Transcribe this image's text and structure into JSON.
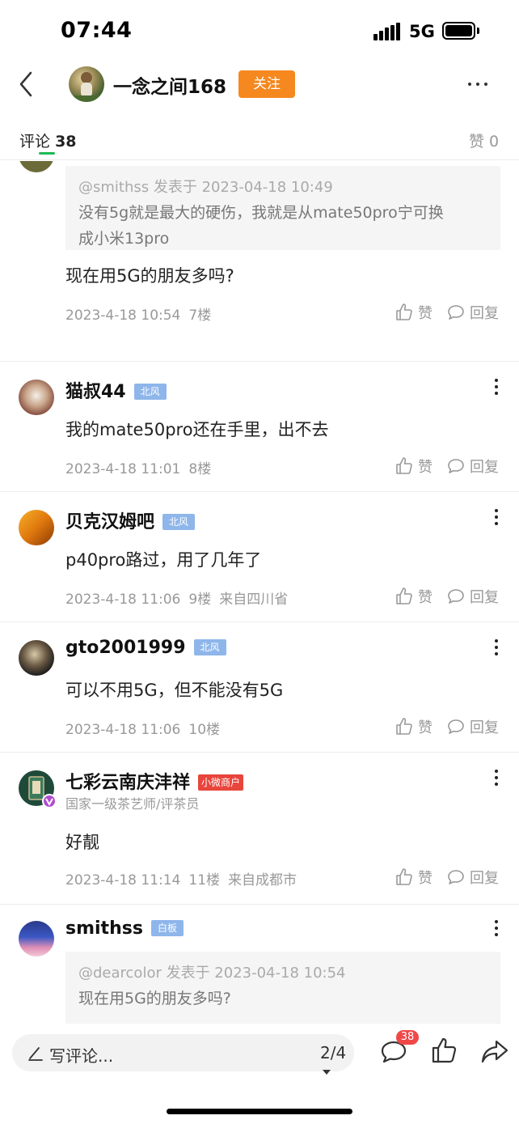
{
  "status_bar": {
    "time": "07:44",
    "network": "5G",
    "battery_level": 1.0
  },
  "header": {
    "author_name": "一念之间168",
    "follow_label": "关注",
    "back_icon": "chevron-left-icon",
    "more_icon": "more-horizontal-icon"
  },
  "tabs": {
    "comments_label": "评论",
    "comments_count": "38",
    "likes_label": "赞 0"
  },
  "actions": {
    "like_label": "赞",
    "reply_label": "回复"
  },
  "comments": [
    {
      "quote": {
        "head": "@smithss 发表于 2023-04-18 10:49",
        "text_line1": "没有5g就是最大的硬伤，我就是从mate50pro宁可换",
        "text_line2": "成小米13pro"
      },
      "text": "现在用5G的朋友多吗?",
      "date": "2023-4-18 10:54",
      "floor": "7楼"
    },
    {
      "name": "猫叔44",
      "badge": "北风",
      "text": "我的mate50pro还在手里，出不去",
      "date": "2023-4-18 11:01",
      "floor": "8楼"
    },
    {
      "name": "贝克汉姆吧",
      "badge": "北风",
      "text": "p40pro路过，用了几年了",
      "date": "2023-4-18 11:06",
      "floor": "9楼",
      "location": "来自四川省"
    },
    {
      "name": "gto2001999",
      "badge": "北风",
      "text": "可以不用5G，但不能没有5G",
      "date": "2023-4-18 11:06",
      "floor": "10楼"
    },
    {
      "name": "七彩云南庆沣祥",
      "badge": "小微商户",
      "subtitle": "国家一级茶艺师/评茶员",
      "text": "好靓",
      "date": "2023-4-18 11:14",
      "floor": "11楼",
      "location": "来自成都市"
    },
    {
      "name": "smithss",
      "badge": "白板",
      "quote": {
        "head": "@dearcolor 发表于 2023-04-18 10:54",
        "text": "现在用5G的朋友多吗?"
      }
    }
  ],
  "bottom_bar": {
    "compose_placeholder": "写评论...",
    "page_indicator": "2/4",
    "comment_count": "38"
  },
  "colors": {
    "follow_button": "#f5881f",
    "badge_blue": "#8eb6ea",
    "badge_red": "#e8453c",
    "tab_underline": "#1db954",
    "count_badge": "#f04848"
  }
}
